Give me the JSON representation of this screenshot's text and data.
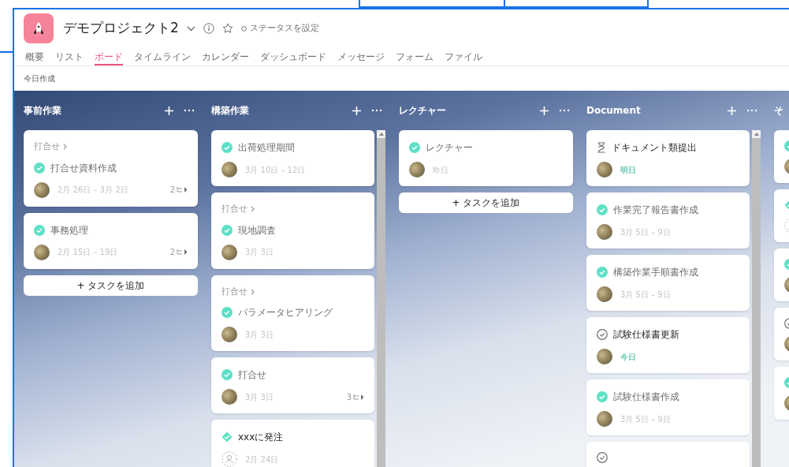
{
  "project": {
    "title": "デモプロジェクト2",
    "status": "ステータスを設定"
  },
  "tabs": [
    {
      "label": "概要",
      "selected": false
    },
    {
      "label": "リスト",
      "selected": false
    },
    {
      "label": "ボード",
      "selected": true
    },
    {
      "label": "タイムライン",
      "selected": false
    },
    {
      "label": "カレンダー",
      "selected": false
    },
    {
      "label": "ダッシュボード",
      "selected": false
    },
    {
      "label": "メッセージ",
      "selected": false
    },
    {
      "label": "フォーム",
      "selected": false
    },
    {
      "label": "ファイル",
      "selected": false
    }
  ],
  "subheader": "今日作成",
  "columns": [
    {
      "title": "事前作業",
      "scrollbar": false,
      "add_task": "+ タスクを追加",
      "tasks": [
        {
          "parent": "打合せ",
          "kind": "done",
          "title": "打合せ資料作成",
          "assigned": true,
          "date": "2月 26日 – 3月 2日",
          "due_soon": false,
          "subtasks": "2"
        },
        {
          "kind": "done",
          "title": "事務処理",
          "assigned": true,
          "date": "2月 15日 – 19日",
          "due_soon": false,
          "subtasks": "2"
        }
      ]
    },
    {
      "title": "構築作業",
      "scrollbar": true,
      "tasks": [
        {
          "kind": "done",
          "title": "出荷処理期間",
          "assigned": true,
          "date": "3月 10日 – 12日",
          "due_soon": false
        },
        {
          "parent": "打合せ",
          "kind": "done",
          "title": "現地調査",
          "assigned": true,
          "date": "3月 3日",
          "due_soon": false
        },
        {
          "parent": "打合せ",
          "kind": "done",
          "title": "パラメータヒアリング",
          "assigned": true,
          "date": "3月 3日",
          "due_soon": false
        },
        {
          "kind": "done",
          "title": "打合せ",
          "assigned": true,
          "date": "3月 3日",
          "due_soon": false,
          "subtasks": "3"
        },
        {
          "kind": "approval",
          "title": "xxxに発注",
          "assigned": false,
          "date": "2月 24日",
          "due_soon": false
        }
      ]
    },
    {
      "title": "レクチャー",
      "scrollbar": false,
      "add_task": "+ タスクを追加",
      "tasks": [
        {
          "kind": "done",
          "title": "レクチャー",
          "assigned": true,
          "date": "昨日",
          "due_soon": false
        }
      ]
    },
    {
      "title": "Document",
      "scrollbar": true,
      "tasks": [
        {
          "kind": "milestone",
          "title": "ドキュメント類提出",
          "assigned": true,
          "date": "明日",
          "due_soon": true
        },
        {
          "kind": "done",
          "title": "作業完了報告書作成",
          "assigned": true,
          "date": "3月 5日 – 9日",
          "due_soon": false
        },
        {
          "kind": "done",
          "title": "構築作業手順書作成",
          "assigned": true,
          "date": "3月 5日 – 9日",
          "due_soon": false
        },
        {
          "kind": "open",
          "title": "試験仕様書更新",
          "assigned": true,
          "date": "今日",
          "due_soon": true
        },
        {
          "kind": "done",
          "title": "試験仕様書作成",
          "assigned": true,
          "date": "3月 5日 – 9日",
          "due_soon": false
        },
        {
          "kind": "open"
        }
      ]
    },
    {
      "title": "そ",
      "scrollbar": false,
      "tasks": [
        {
          "kind": "done",
          "assigned": true
        },
        {
          "kind": "approval",
          "assigned": false
        },
        {
          "kind": "done",
          "assigned": true
        },
        {
          "kind": "open",
          "assigned": true
        },
        {
          "kind": "done",
          "assigned": true
        }
      ]
    }
  ]
}
